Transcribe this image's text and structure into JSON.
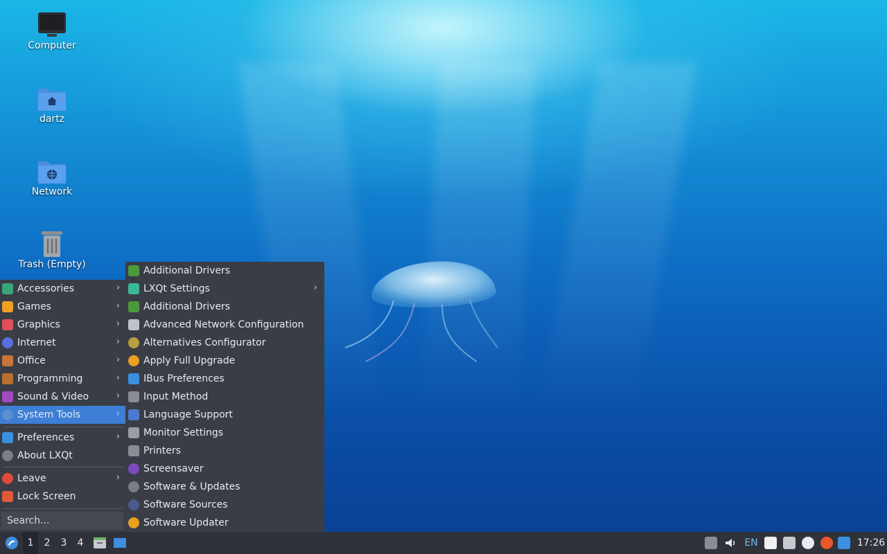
{
  "desktop": {
    "icons": [
      {
        "label": "Computer"
      },
      {
        "label": "dartz"
      },
      {
        "label": "Network"
      },
      {
        "label": "Trash (Empty)"
      }
    ]
  },
  "menu": {
    "items": [
      {
        "label": "Accessories",
        "icon": "accessories-icon",
        "color": "#3aa57a",
        "has_submenu": true
      },
      {
        "label": "Games",
        "icon": "games-icon",
        "color": "#f0a020",
        "has_submenu": true
      },
      {
        "label": "Graphics",
        "icon": "graphics-icon",
        "color": "#e0505a",
        "has_submenu": true
      },
      {
        "label": "Internet",
        "icon": "internet-icon",
        "color": "#5a6ee0",
        "has_submenu": true
      },
      {
        "label": "Office",
        "icon": "office-icon",
        "color": "#c8743a",
        "has_submenu": true
      },
      {
        "label": "Programming",
        "icon": "programming-icon",
        "color": "#b8702e",
        "has_submenu": true
      },
      {
        "label": "Sound & Video",
        "icon": "sound-video-icon",
        "color": "#a04ac0",
        "has_submenu": true
      },
      {
        "label": "System Tools",
        "icon": "system-tools-icon",
        "color": "#5a8fd0",
        "has_submenu": true,
        "active": true
      },
      {
        "label": "Preferences",
        "icon": "preferences-icon",
        "color": "#3a8fe0",
        "has_submenu": true
      },
      {
        "label": "About LXQt",
        "icon": "about-icon",
        "color": "#7a7d85",
        "has_submenu": false
      },
      {
        "label": "Leave",
        "icon": "power-icon",
        "color": "#e04a3a",
        "has_submenu": true
      },
      {
        "label": "Lock Screen",
        "icon": "lock-icon",
        "color": "#e05a3a",
        "has_submenu": false
      }
    ],
    "search_placeholder": "Search..."
  },
  "submenu": {
    "items": [
      {
        "label": "Additional Drivers",
        "icon": "chip-icon",
        "color": "#4a9a3a"
      },
      {
        "label": "LXQt Settings",
        "icon": "lxqt-settings-icon",
        "color": "#3ab89a",
        "has_submenu": true
      },
      {
        "label": "Additional Drivers",
        "icon": "chip-icon",
        "color": "#4a9a3a"
      },
      {
        "label": "Advanced Network Configuration",
        "icon": "network-config-icon",
        "color": "#c0c2c8"
      },
      {
        "label": "Alternatives Configurator",
        "icon": "alternatives-icon",
        "color": "#b8a040"
      },
      {
        "label": "Apply Full Upgrade",
        "icon": "upgrade-icon",
        "color": "#e8a020"
      },
      {
        "label": "IBus Preferences",
        "icon": "info-icon",
        "color": "#3a8fe0"
      },
      {
        "label": "Input Method",
        "icon": "keyboard-icon",
        "color": "#8a8d95"
      },
      {
        "label": "Language Support",
        "icon": "language-icon",
        "color": "#4a7ad0"
      },
      {
        "label": "Monitor Settings",
        "icon": "monitor-icon",
        "color": "#9a9da5"
      },
      {
        "label": "Printers",
        "icon": "printer-icon",
        "color": "#8a8d95"
      },
      {
        "label": "Screensaver",
        "icon": "screensaver-icon",
        "color": "#7a4ac0"
      },
      {
        "label": "Software & Updates",
        "icon": "software-updates-icon",
        "color": "#7a7d85"
      },
      {
        "label": "Software Sources",
        "icon": "software-sources-icon",
        "color": "#4a5a8a"
      },
      {
        "label": "Software Updater",
        "icon": "updater-icon",
        "color": "#e8a020"
      }
    ]
  },
  "taskbar": {
    "workspaces": [
      "1",
      "2",
      "3",
      "4"
    ],
    "active_workspace": "1",
    "keyboard_layout": "EN",
    "clock": "17:26"
  }
}
